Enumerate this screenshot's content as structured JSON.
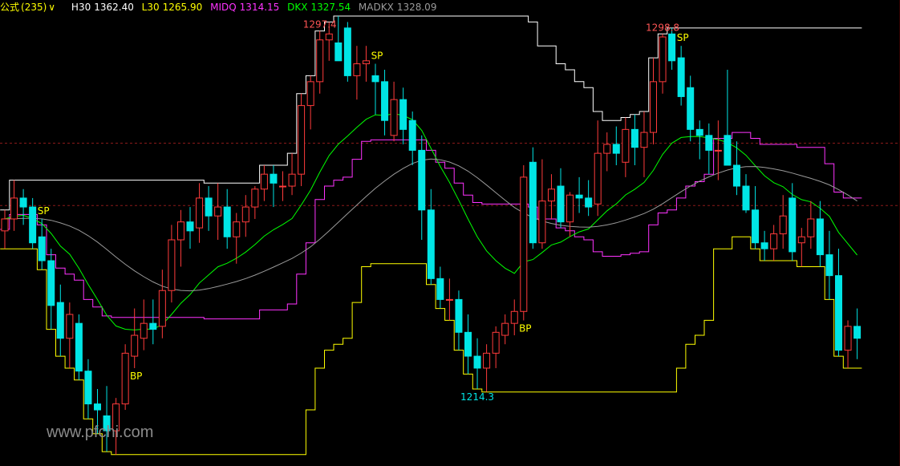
{
  "header": {
    "formula_label": "公式",
    "formula_count": "(235)",
    "dropdown_icon": "chevron-down-icon",
    "indicators": [
      {
        "name": "H30",
        "value": "1362.40",
        "color": "#ffffff"
      },
      {
        "name": "L30",
        "value": "1265.90",
        "color": "#ffff00"
      },
      {
        "name": "MIDQ",
        "value": "1314.15",
        "color": "#ff33ff"
      },
      {
        "name": "DKX",
        "value": "1327.54",
        "color": "#00ff00"
      },
      {
        "name": "MADKX",
        "value": "1328.09",
        "color": "#9a9a9a"
      }
    ]
  },
  "watermark": "www.pfchi.com",
  "chart_data": {
    "type": "candlestick",
    "ylim": [
      1190,
      1340
    ],
    "reference_levels": [
      1297.4,
      1276.5
    ],
    "annotations": {
      "high_labels": [
        {
          "text": "1297.4",
          "index": 34
        },
        {
          "text": "1298.8",
          "index": 71
        }
      ],
      "low_labels": [
        {
          "text": "1214.3",
          "index": 51
        }
      ],
      "signals": [
        {
          "text": "SP",
          "index": 4
        },
        {
          "text": "BP",
          "index": 14
        },
        {
          "text": "SP",
          "index": 40
        },
        {
          "text": "BP",
          "index": 56
        },
        {
          "text": "SP",
          "index": 73
        }
      ]
    },
    "colors": {
      "up": "#ff3b3b",
      "down": "#00e5e5",
      "sp": "#ffff00",
      "bp": "#ffff00",
      "high_label": "#ff5555",
      "low_label": "#00e5e5",
      "H30": "#ffffff",
      "L30": "#ffff00",
      "MIDQ": "#ff33ff",
      "DKX": "#00ff00",
      "MADKX": "#9a9a9a"
    },
    "candles": [
      [
        1268,
        1275,
        1262,
        1272
      ],
      [
        1272,
        1285,
        1268,
        1279
      ],
      [
        1279,
        1282,
        1270,
        1276
      ],
      [
        1276,
        1279,
        1262,
        1264
      ],
      [
        1266,
        1272,
        1255,
        1258
      ],
      [
        1258,
        1262,
        1235,
        1243
      ],
      [
        1244,
        1250,
        1226,
        1232
      ],
      [
        1232,
        1244,
        1222,
        1240
      ],
      [
        1237,
        1240,
        1218,
        1221
      ],
      [
        1221,
        1225,
        1205,
        1210
      ],
      [
        1210,
        1215,
        1200,
        1208
      ],
      [
        1206,
        1216,
        1194,
        1201
      ],
      [
        1201,
        1212,
        1193,
        1210
      ],
      [
        1210,
        1230,
        1208,
        1227
      ],
      [
        1226,
        1242,
        1222,
        1233
      ],
      [
        1232,
        1245,
        1228,
        1237
      ],
      [
        1237,
        1245,
        1230,
        1235
      ],
      [
        1236,
        1255,
        1232,
        1248
      ],
      [
        1248,
        1270,
        1244,
        1265
      ],
      [
        1265,
        1275,
        1256,
        1271
      ],
      [
        1271,
        1276,
        1262,
        1268
      ],
      [
        1269,
        1284,
        1264,
        1279
      ],
      [
        1279,
        1283,
        1268,
        1273
      ],
      [
        1273,
        1284,
        1265,
        1276
      ],
      [
        1276,
        1282,
        1262,
        1266
      ],
      [
        1266,
        1274,
        1257,
        1271
      ],
      [
        1271,
        1280,
        1266,
        1276
      ],
      [
        1276,
        1283,
        1272,
        1282
      ],
      [
        1282,
        1290,
        1278,
        1287
      ],
      [
        1287,
        1290,
        1276,
        1284
      ],
      [
        1283,
        1288,
        1278,
        1283
      ],
      [
        1283,
        1294,
        1280,
        1287
      ],
      [
        1287,
        1314,
        1283,
        1310
      ],
      [
        1310,
        1320,
        1302,
        1318
      ],
      [
        1318,
        1335,
        1314,
        1332
      ],
      [
        1332,
        1338,
        1325,
        1334
      ],
      [
        1331,
        1340,
        1325,
        1325
      ],
      [
        1336,
        1338,
        1318,
        1320
      ],
      [
        1320,
        1330,
        1312,
        1324
      ],
      [
        1324,
        1330,
        1318,
        1325
      ],
      [
        1320,
        1324,
        1307,
        1318
      ],
      [
        1318,
        1322,
        1300,
        1305
      ],
      [
        1300,
        1318,
        1298,
        1312
      ],
      [
        1312,
        1316,
        1297,
        1302
      ],
      [
        1305,
        1308,
        1290,
        1295
      ],
      [
        1295,
        1300,
        1265,
        1275
      ],
      [
        1275,
        1282,
        1250,
        1252
      ],
      [
        1252,
        1256,
        1242,
        1245
      ],
      [
        1245,
        1252,
        1238,
        1245
      ],
      [
        1245,
        1248,
        1228,
        1234
      ],
      [
        1234,
        1240,
        1220,
        1226
      ],
      [
        1226,
        1232,
        1215,
        1222
      ],
      [
        1222,
        1230,
        1214,
        1227
      ],
      [
        1227,
        1236,
        1222,
        1234
      ],
      [
        1233,
        1240,
        1230,
        1237
      ],
      [
        1237,
        1245,
        1233,
        1241
      ],
      [
        1241,
        1290,
        1238,
        1286
      ],
      [
        1291,
        1296,
        1262,
        1264
      ],
      [
        1264,
        1292,
        1262,
        1278
      ],
      [
        1278,
        1287,
        1272,
        1282
      ],
      [
        1283,
        1289,
        1269,
        1271
      ],
      [
        1271,
        1281,
        1266,
        1280
      ],
      [
        1280,
        1286,
        1274,
        1279
      ],
      [
        1279,
        1285,
        1273,
        1276
      ],
      [
        1277,
        1305,
        1273,
        1294
      ],
      [
        1294,
        1301,
        1288,
        1297
      ],
      [
        1297,
        1303,
        1290,
        1294
      ],
      [
        1291,
        1306,
        1286,
        1302
      ],
      [
        1302,
        1307,
        1290,
        1296
      ],
      [
        1296,
        1308,
        1286,
        1301
      ],
      [
        1301,
        1326,
        1297,
        1318
      ],
      [
        1318,
        1334,
        1314,
        1333
      ],
      [
        1334,
        1336,
        1322,
        1325
      ],
      [
        1326,
        1330,
        1310,
        1313
      ],
      [
        1316,
        1320,
        1298,
        1302
      ],
      [
        1302,
        1305,
        1292,
        1300
      ],
      [
        1300,
        1304,
        1287,
        1295
      ],
      [
        1295,
        1305,
        1285,
        1295
      ],
      [
        1300,
        1322,
        1290,
        1290
      ],
      [
        1290,
        1298,
        1280,
        1283
      ],
      [
        1283,
        1287,
        1274,
        1275
      ],
      [
        1275,
        1283,
        1262,
        1264
      ],
      [
        1264,
        1268,
        1258,
        1262
      ],
      [
        1262,
        1270,
        1258,
        1267
      ],
      [
        1267,
        1280,
        1262,
        1273
      ],
      [
        1279,
        1284,
        1258,
        1261
      ],
      [
        1264,
        1269,
        1256,
        1266
      ],
      [
        1266,
        1278,
        1262,
        1272
      ],
      [
        1272,
        1278,
        1256,
        1260
      ],
      [
        1260,
        1268,
        1245,
        1253
      ],
      [
        1253,
        1262,
        1226,
        1228
      ],
      [
        1228,
        1238,
        1222,
        1236
      ],
      [
        1236,
        1242,
        1225,
        1232
      ]
    ]
  }
}
